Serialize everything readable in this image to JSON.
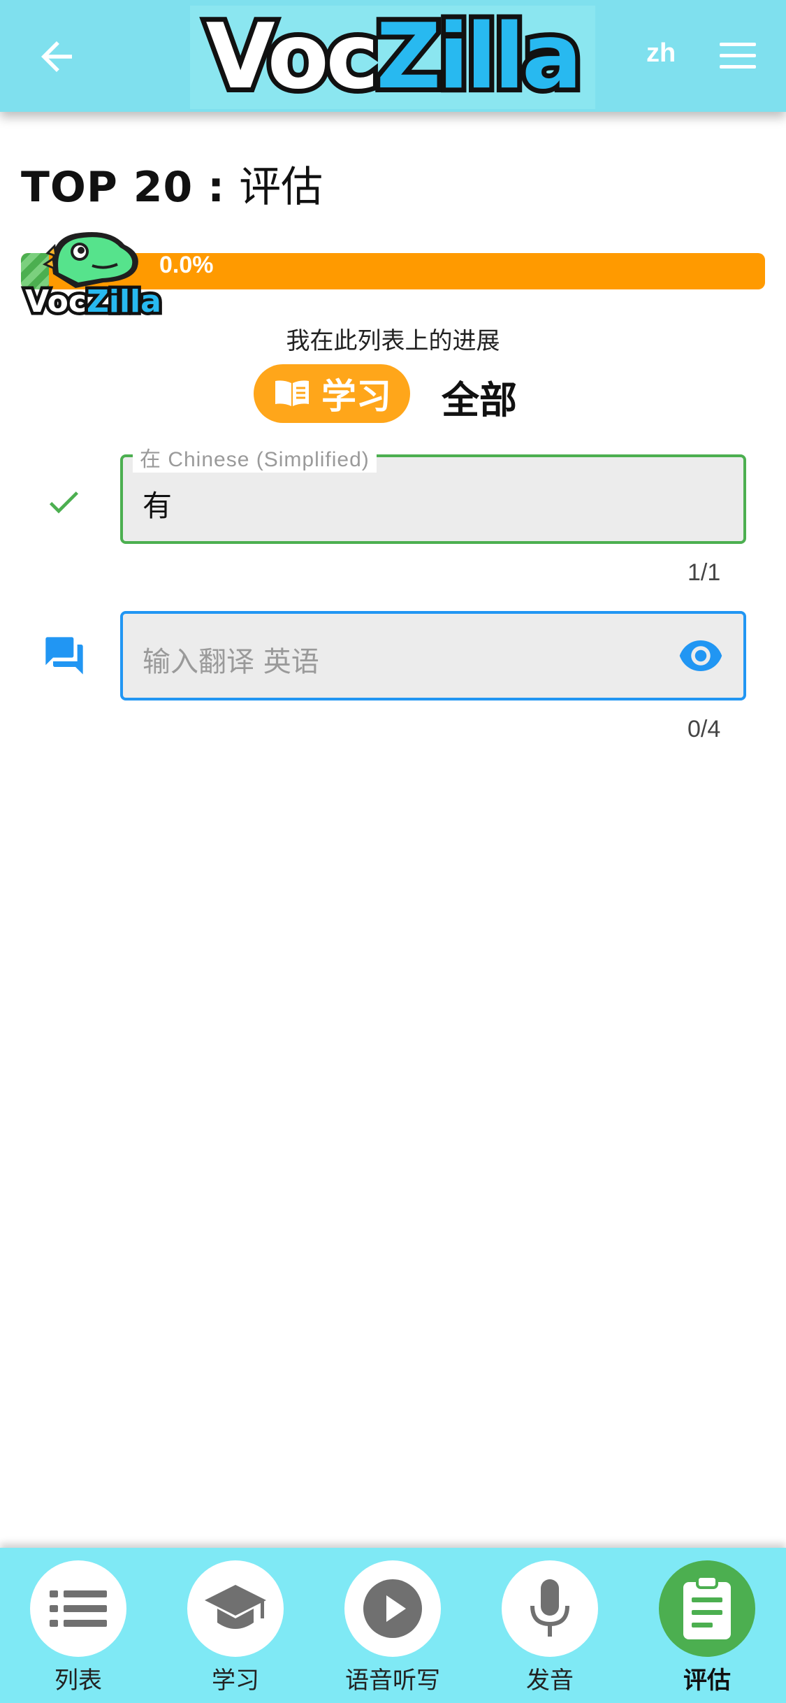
{
  "header": {
    "logo_voc": "Voc",
    "logo_zilla": "Zilla",
    "language": "zh"
  },
  "title": {
    "prefix": "TOP 20",
    "separator": " : ",
    "mode": "评估"
  },
  "progress": {
    "value": 0.0,
    "label": "0.0%",
    "caption": "我在此列表上的进展",
    "mascot_text": "VocZilla"
  },
  "toggle": {
    "study_label": "学习",
    "all_label": "全部",
    "selected": "学习"
  },
  "answer_field": {
    "legend": "在 Chinese (Simplified)",
    "value": "有",
    "counter": "1/1",
    "status": "correct"
  },
  "input_field": {
    "placeholder": "输入翻译 英语",
    "value": "",
    "counter": "0/4"
  },
  "bottom_nav": {
    "items": [
      {
        "label": "列表",
        "icon": "list-icon"
      },
      {
        "label": "学习",
        "icon": "graduation-cap-icon"
      },
      {
        "label": "语音听写",
        "icon": "play-icon"
      },
      {
        "label": "发音",
        "icon": "microphone-icon"
      },
      {
        "label": "评估",
        "icon": "clipboard-icon",
        "active": true
      }
    ]
  },
  "colors": {
    "header_bg": "#7fe0ee",
    "accent_orange": "#ff9a00",
    "success_green": "#4caf50",
    "input_blue": "#2196f3"
  }
}
